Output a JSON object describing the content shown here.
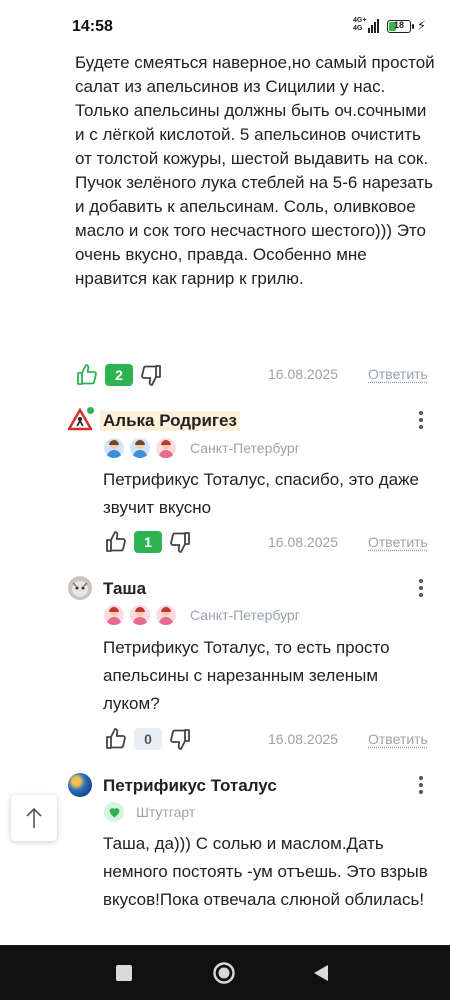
{
  "status_bar": {
    "time": "14:58",
    "network_top": "4G+",
    "network_bottom": "4G",
    "battery": "18"
  },
  "comments": [
    {
      "text": "Будете смеяться наверное,но самый простой салат из апельсинов из Сицилии у нас. Только апельсины должны быть оч.сочными и с лёгкой кислотой. 5 апельсинов очистить от толстой кожуры, шестой выдавить на сок. Пучок зелёного лука стеблей на 5-6 нарезать и добавить к апельсинам. Соль, оливковое масло и сок того несчастного шестого))) Это очень вкусно, правда. Особенно мне нравится как гарнир к грилю.",
      "likes": "2",
      "date": "16.08.2025",
      "reply": "Ответить"
    },
    {
      "author": "Алька Родригез",
      "city": "Санкт-Петербург",
      "text": "Петрификус Тоталус, спасибо, это даже звучит вкусно",
      "likes": "1",
      "date": "16.08.2025",
      "reply": "Ответить"
    },
    {
      "author": "Таша",
      "city": "Санкт-Петербург",
      "text": "Петрификус Тоталус, то есть просто апельсины с нарезанным зеленым луком?",
      "likes": "0",
      "date": "16.08.2025",
      "reply": "Ответить"
    },
    {
      "author": "Петрификус Тоталус",
      "city": "Штутгарт",
      "text": "Таша, да))) С солью и маслом.Дать немного постоять -ум отъешь. Это взрыв вкусов!Пока отвечала слюной облилась!"
    }
  ],
  "icons": {
    "like": "thumbs-up-icon",
    "dislike": "thumbs-down-icon",
    "more": "kebab-menu-icon",
    "scroll": "arrow-up-icon",
    "nav": [
      "square-icon",
      "circle-icon",
      "triangle-back-icon"
    ]
  },
  "colors": {
    "like_active": "#2eb352",
    "muted_text": "#9aa3ab",
    "highlight": "#fdf0da"
  }
}
